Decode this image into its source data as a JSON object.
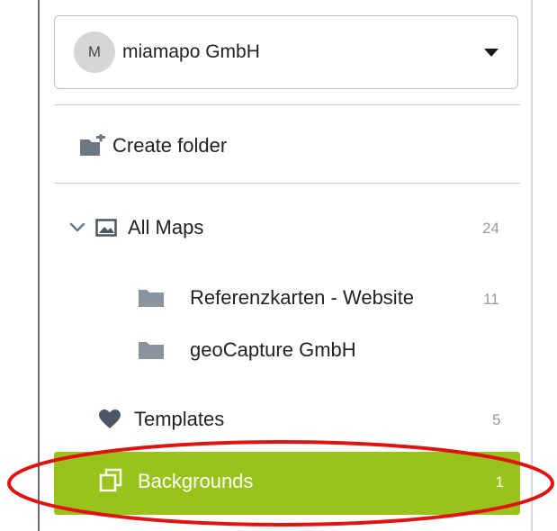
{
  "org_selector": {
    "avatar_initial": "M",
    "name": "miamapo GmbH"
  },
  "actions": {
    "create_folder": "Create folder"
  },
  "tree": {
    "all_maps": {
      "label": "All Maps",
      "count": "24"
    },
    "folders": [
      {
        "label": "Referenzkarten - Website",
        "count": "11"
      },
      {
        "label": "geoCapture GmbH",
        "count": ""
      }
    ]
  },
  "templates": {
    "label": "Templates",
    "count": "5"
  },
  "backgrounds": {
    "label": "Backgrounds",
    "count": "1"
  },
  "colors": {
    "active_green": "#99c31a",
    "icon_gray": "#6b7785",
    "annotation_red": "#e01313"
  }
}
